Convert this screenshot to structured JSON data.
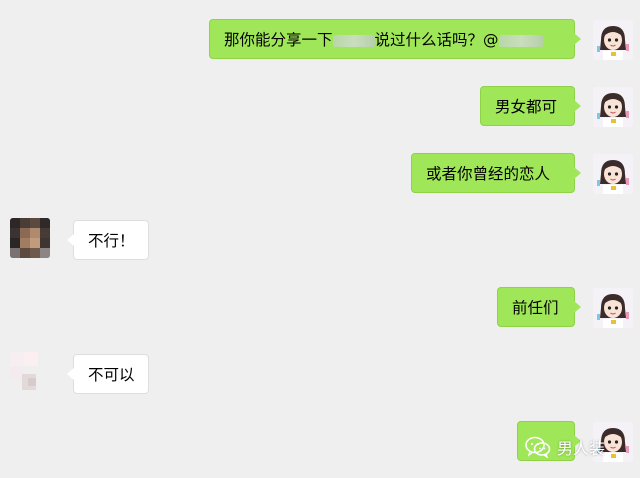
{
  "messages": [
    {
      "side": "me",
      "text_before": "那你能分享一下",
      "text_after": "说过什么话吗？@"
    },
    {
      "side": "me",
      "text": "男女都可"
    },
    {
      "side": "me",
      "text": "或者你曾经的恋人"
    },
    {
      "side": "them",
      "text": "不行！"
    },
    {
      "side": "me",
      "text": "前任们"
    },
    {
      "side": "them",
      "text": "不可以"
    },
    {
      "side": "me",
      "text": ""
    }
  ],
  "watermark": {
    "icon": "wechat-icon",
    "text": "男人装"
  },
  "icons": {
    "my_avatar": "cartoon-girl-avatar-icon",
    "their_avatar": "pixelated-avatar-icon"
  },
  "colors": {
    "background": "#efefef",
    "my_bubble": "#9fe658",
    "their_bubble": "#ffffff"
  }
}
